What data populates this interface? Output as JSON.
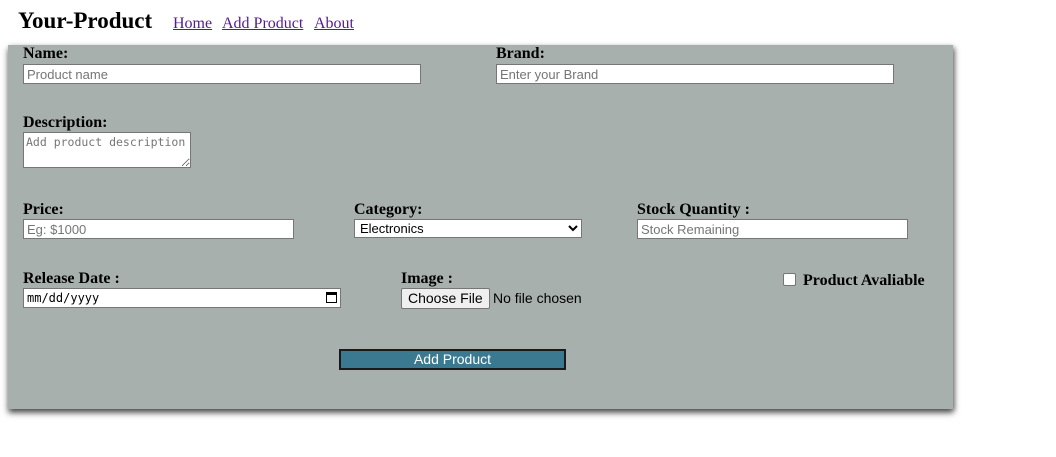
{
  "nav": {
    "brand": "Your-Product",
    "links": [
      "Home",
      "Add Product",
      "About"
    ]
  },
  "form": {
    "name": {
      "label": "Name:",
      "placeholder": "Product name"
    },
    "brand": {
      "label": "Brand:",
      "placeholder": "Enter your Brand"
    },
    "description": {
      "label": "Description:",
      "placeholder": "Add product description"
    },
    "price": {
      "label": "Price:",
      "placeholder": "Eg: $1000"
    },
    "category": {
      "label": "Category:",
      "selected": "Electronics"
    },
    "stock": {
      "label": "Stock Quantity :",
      "placeholder": "Stock Remaining"
    },
    "release_date": {
      "label": "Release Date :",
      "placeholder": "mm/dd/yyyy"
    },
    "image": {
      "label": "Image :",
      "button": "Choose File",
      "status": "No file chosen"
    },
    "available": {
      "label": "Product Avaliable",
      "checked": false
    },
    "submit": "Add Product"
  },
  "colors": {
    "panel": "#a8b0ad",
    "submit_bg": "#3a7990",
    "link": "#551a8b"
  }
}
